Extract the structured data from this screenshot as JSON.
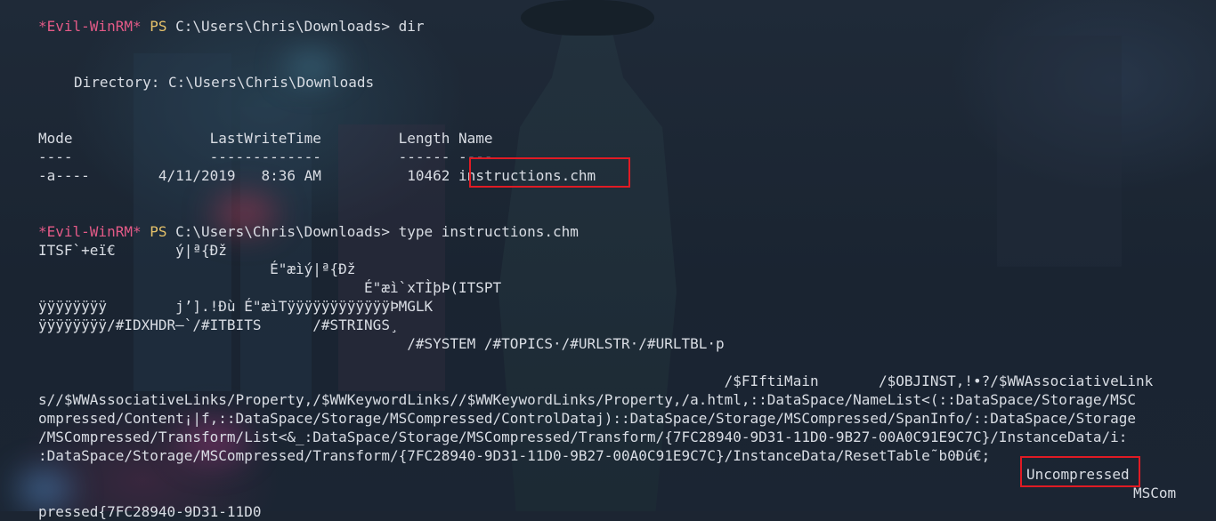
{
  "prompt": {
    "evil": "*Evil-WinRM*",
    "ps": "PS",
    "path": "C:\\Users\\Chris\\Downloads>"
  },
  "commands": {
    "dir": "dir",
    "type": "type instructions.chm"
  },
  "directory_line": "Directory: C:\\Users\\Chris\\Downloads",
  "listing": {
    "header": "Mode                LastWriteTime         Length Name",
    "underline": "----                -------------         ------ ----",
    "row": {
      "mode": "-a----",
      "date": "4/11/2019",
      "time": "8:36 AM",
      "length": "10462",
      "name": "instructions.chm"
    }
  },
  "output": {
    "l1": "ITSF`+eï€       ý|ª{Ðž",
    "l2": "                           É\"æìý|ª{Ðž",
    "l3": "                                      É\"æì`xTÌþÞ(ITSPT",
    "l4": "ÿÿÿÿÿÿÿÿ        j’].!Ðù É\"æìTÿÿÿÿÿÿÿÿÿÿÿÿÞMGLK",
    "l5": "ÿÿÿÿÿÿÿÿ/#IDXHDR–`/#ITBITS      /#STRINGS¸",
    "l6": "                                           /#SYSTEM /#TOPICS·/#URLSTR·/#URLTBL·p",
    "l7": "                                                                                /$FIftiMain       /$OBJINST,!•?/$WWAssociativeLink",
    "l8": "s//$WWAssociativeLinks/Property,/$WWKeywordLinks//$WWKeywordLinks/Property,/a.html,::DataSpace/NameList<(::DataSpace/Storage/MSC",
    "l9": "ompressed/Content¡|f,::DataSpace/Storage/MSCompressed/ControlDataj)::DataSpace/Storage/MSCompressed/SpanInfo/::DataSpace/Storage",
    "l10": "/MSCompressed/Transform/List<&_:DataSpace/Storage/MSCompressed/Transform/{7FC28940-9D31-11D0-9B27-00A0C91E9C7C}/InstanceData/i:",
    "l11": ":DataSpace/Storage/MSCompressed/Transform/{7FC28940-9D31-11D0-9B27-00A0C91E9C7C}/InstanceData/ResetTable˜b0Ðú€;",
    "uncompressed": "Uncompressed",
    "mscom": "MSCom",
    "l14": "pressed{7FC28940-9D31-11D0"
  },
  "colors": {
    "evil": "#e35a87",
    "ps": "#e6c26a",
    "text": "#d9dde4",
    "highlight": "#e01b24"
  }
}
